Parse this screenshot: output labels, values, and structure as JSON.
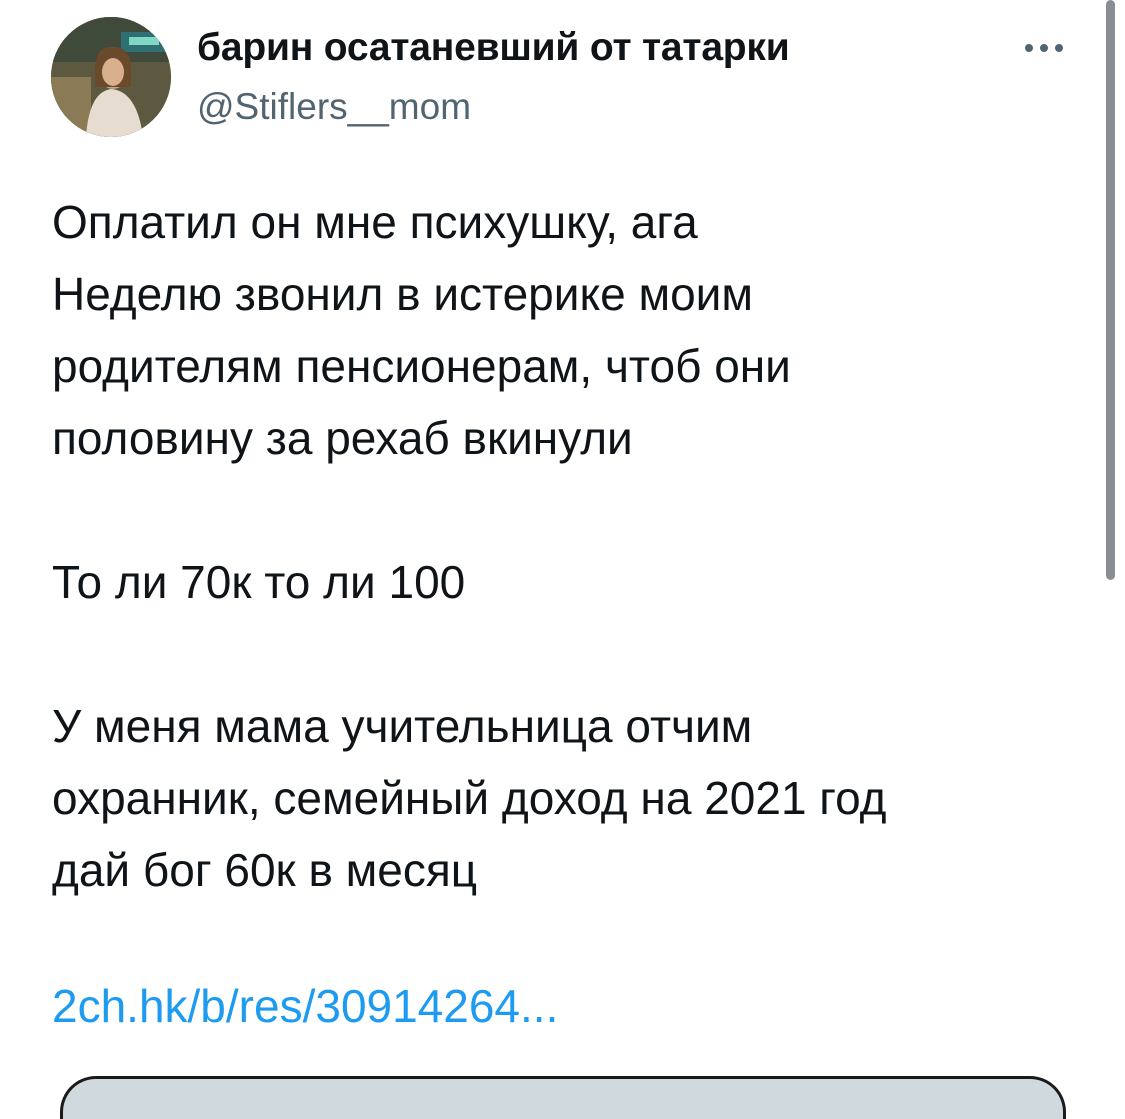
{
  "author": {
    "name": "барин осатаневший от татарки",
    "handle": "@Stiflers__mom"
  },
  "tweet": {
    "paragraphs": [
      [
        "Оплатил он мне психушку, ага",
        "Неделю звонил в истерике моим",
        "родителям пенсионерам, чтоб они",
        "половину за рехаб вкинули"
      ],
      [
        "То ли 70к то ли 100"
      ],
      [
        "У меня мама учительница отчим",
        "охранник, семейный доход на 2021 год",
        "дай бог 60к в месяц"
      ]
    ],
    "link_text": "2ch.hk/b/res/30914264..."
  },
  "icons": {
    "more": "more-horizontal-icon",
    "avatar": "avatar-photo"
  },
  "colors": {
    "text": "#0f1419",
    "secondary": "#536471",
    "link": "#1d9bf0"
  }
}
